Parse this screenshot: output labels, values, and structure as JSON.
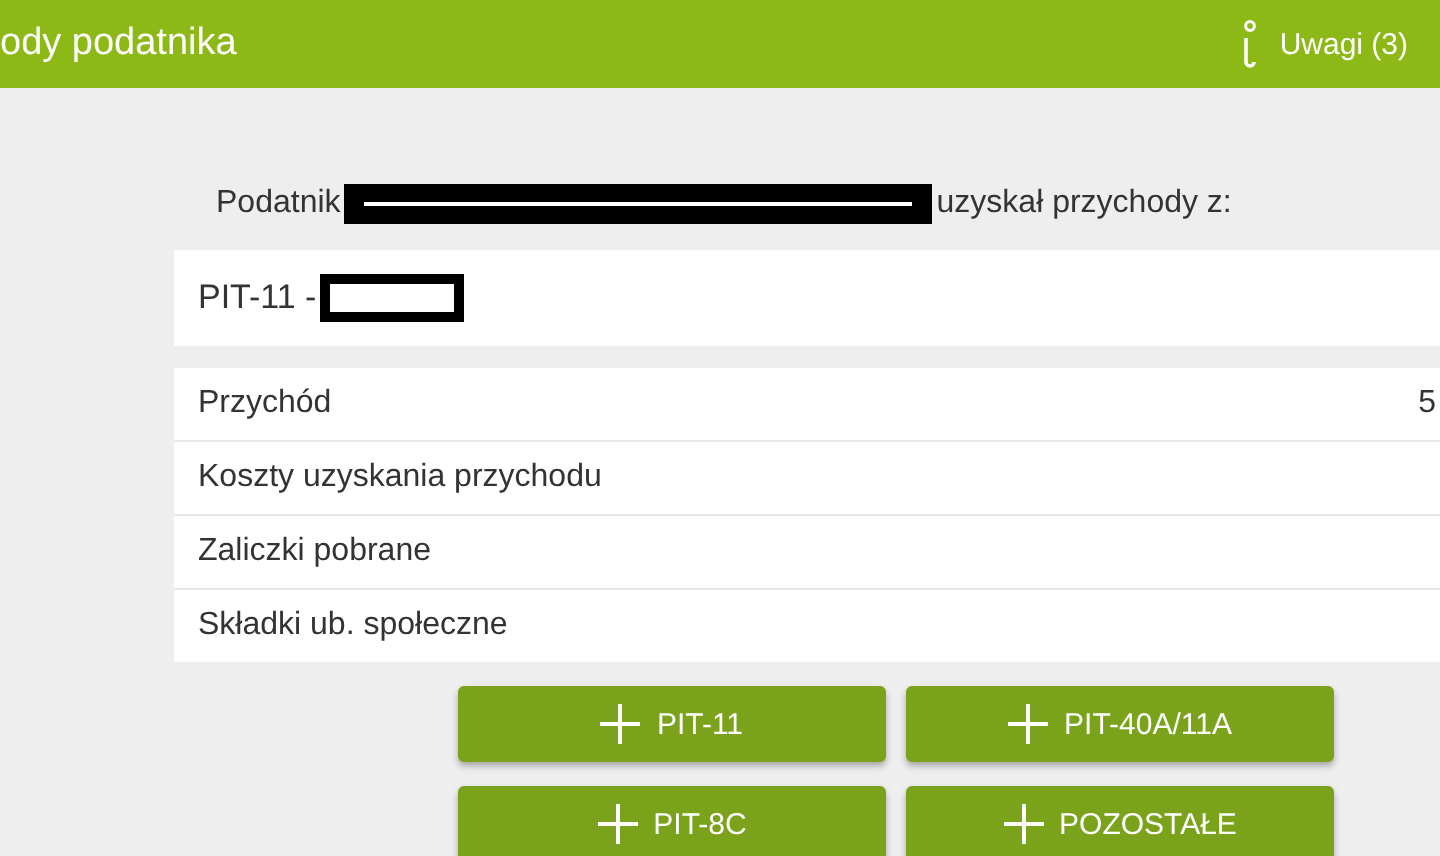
{
  "header": {
    "title": "ody podatnika",
    "notes_button": "Uwagi (3)"
  },
  "intro": {
    "before": "Podatnik",
    "after": "uzyskał przychody z:"
  },
  "form_card": {
    "title": "PIT-11 -"
  },
  "rows": [
    {
      "label": "Przychód",
      "value": "5"
    },
    {
      "label": "Koszty uzyskania przychodu"
    },
    {
      "label": "Zaliczki pobrane"
    },
    {
      "label": "Składki ub. społeczne"
    }
  ],
  "buttons": [
    "PIT-11",
    "PIT-40A/11A",
    "PIT-8C",
    "POZOSTAŁE"
  ]
}
